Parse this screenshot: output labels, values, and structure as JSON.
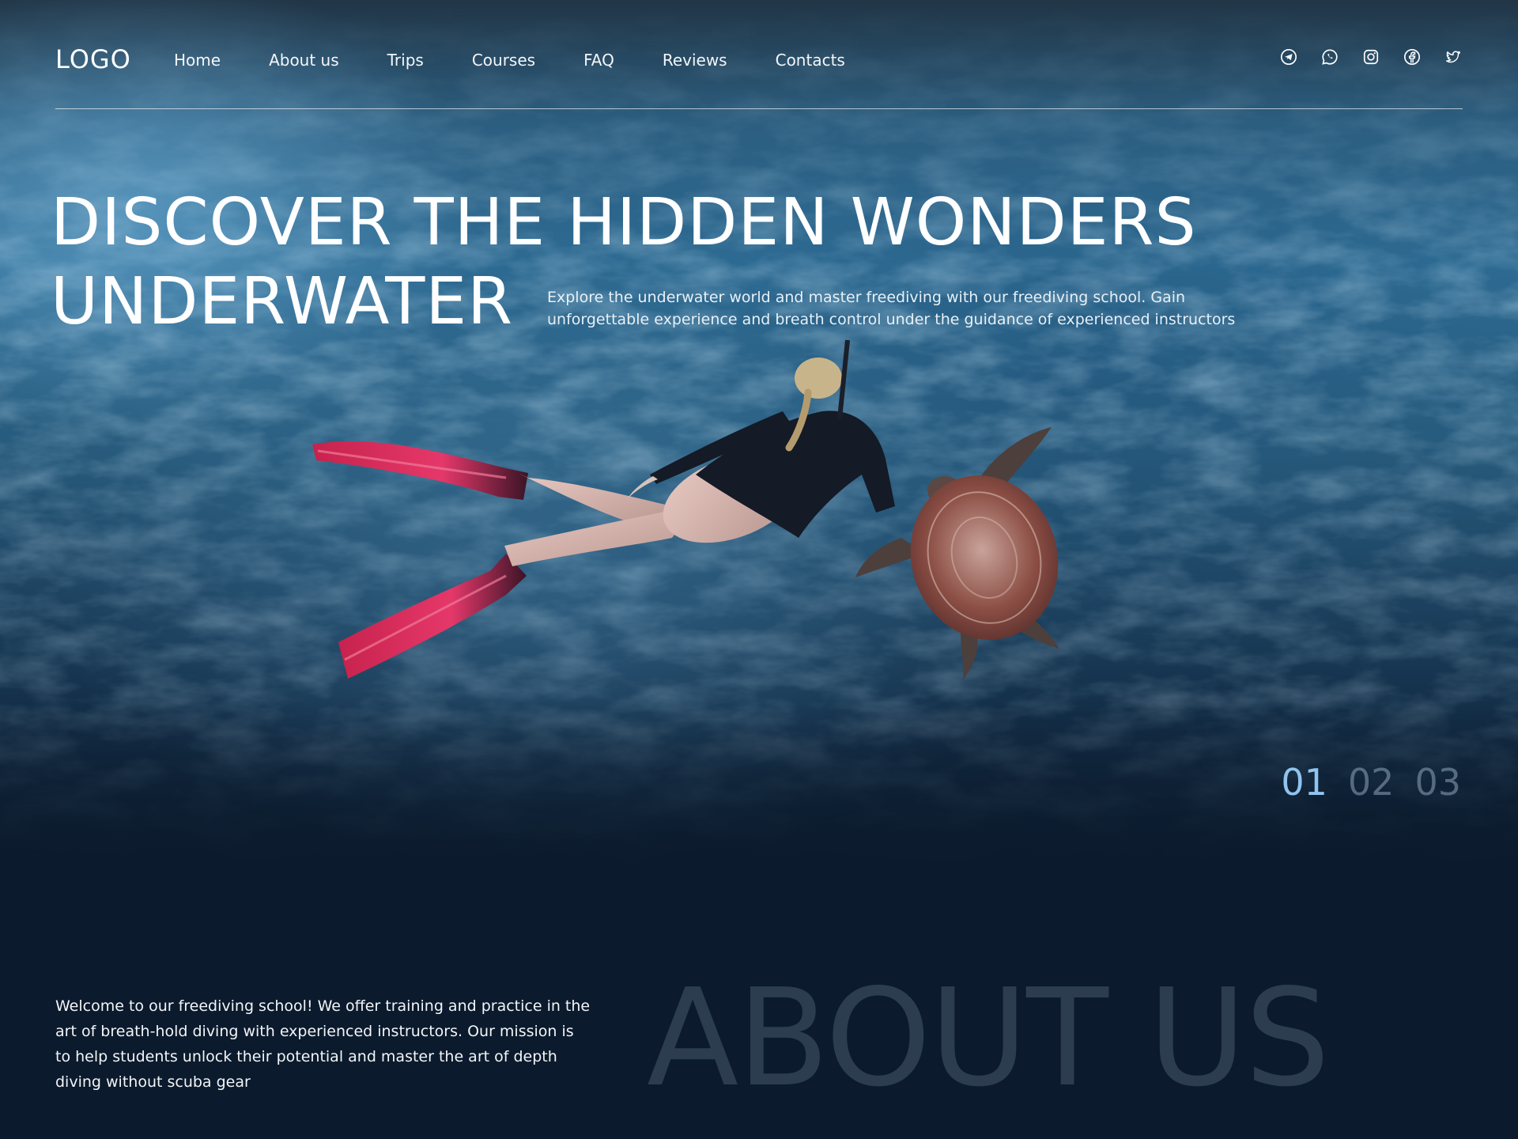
{
  "header": {
    "logo": "LOGO",
    "nav": [
      "Home",
      "About us",
      "Trips",
      "Courses",
      "FAQ",
      "Reviews",
      "Contacts"
    ],
    "socials": [
      "telegram-icon",
      "whatsapp-icon",
      "instagram-icon",
      "facebook-icon",
      "twitter-icon"
    ]
  },
  "hero": {
    "title_line1": "DISCOVER THE HIDDEN WONDERS",
    "title_line2": "UNDERWATER",
    "description": "Explore the underwater world and master freediving with our freediving school. Gain unforgettable experience and breath control under the guidance of experienced instructors",
    "slides": [
      "01",
      "02",
      "03"
    ],
    "active_slide": "01"
  },
  "about": {
    "text": "Welcome to our freediving school! We offer training and practice in the art of breath-hold diving with experienced instructors. Our mission is to help students unlock their potential and master the art of depth diving without scuba gear",
    "title": "ABOUT US"
  },
  "colors": {
    "background": "#0b1a2c",
    "accent": "#8fc4ef",
    "fin": "#e0305a",
    "about_title": "#2c3d50"
  }
}
